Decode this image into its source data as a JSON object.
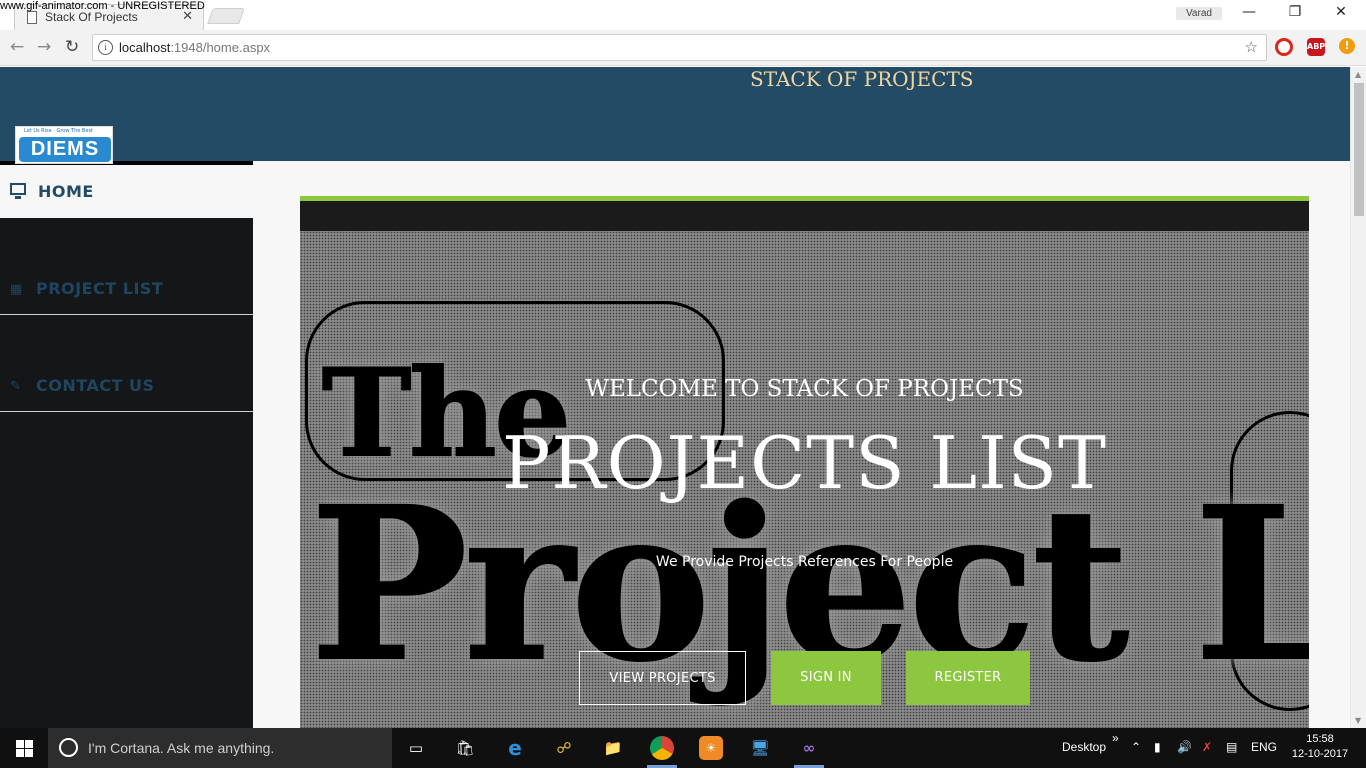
{
  "watermark": "www.gif-animator.com - UNREGISTERED",
  "browser": {
    "tab_title": "Stack Of Projects",
    "tab_close": "✕",
    "user_name": "Varad",
    "url_host": "localhost",
    "url_rest": ":1948/home.aspx",
    "ext_abp": "ABP",
    "ext_alert": "!"
  },
  "site": {
    "title": "STACK OF PROJECTS",
    "logo_tagline": "Let Us Rise · Grow The Best",
    "logo_text": "DIEMS"
  },
  "sidebar": {
    "items": [
      {
        "label": "HOME",
        "icon": "desktop-icon"
      },
      {
        "label": "PROJECT LIST",
        "icon": "table-icon"
      },
      {
        "label": "CONTACT US",
        "icon": "edit-icon"
      }
    ]
  },
  "hero": {
    "welcome": "WELCOME TO STACK OF PROJECTS",
    "headline": "PROJECTS LIST",
    "subtitle": "We Provide Projects References For People",
    "bg_word_1": "The",
    "bg_word_2": "Project L",
    "buttons": {
      "view": "VIEW PROJECTS",
      "signin": "SIGN IN",
      "register": "REGISTER"
    },
    "accent_color": "#8dc63f"
  },
  "taskbar": {
    "search_placeholder": "I'm Cortana. Ask me anything.",
    "desktop_label": "Desktop",
    "language": "ENG",
    "time": "15:58",
    "date": "12-10-2017"
  }
}
